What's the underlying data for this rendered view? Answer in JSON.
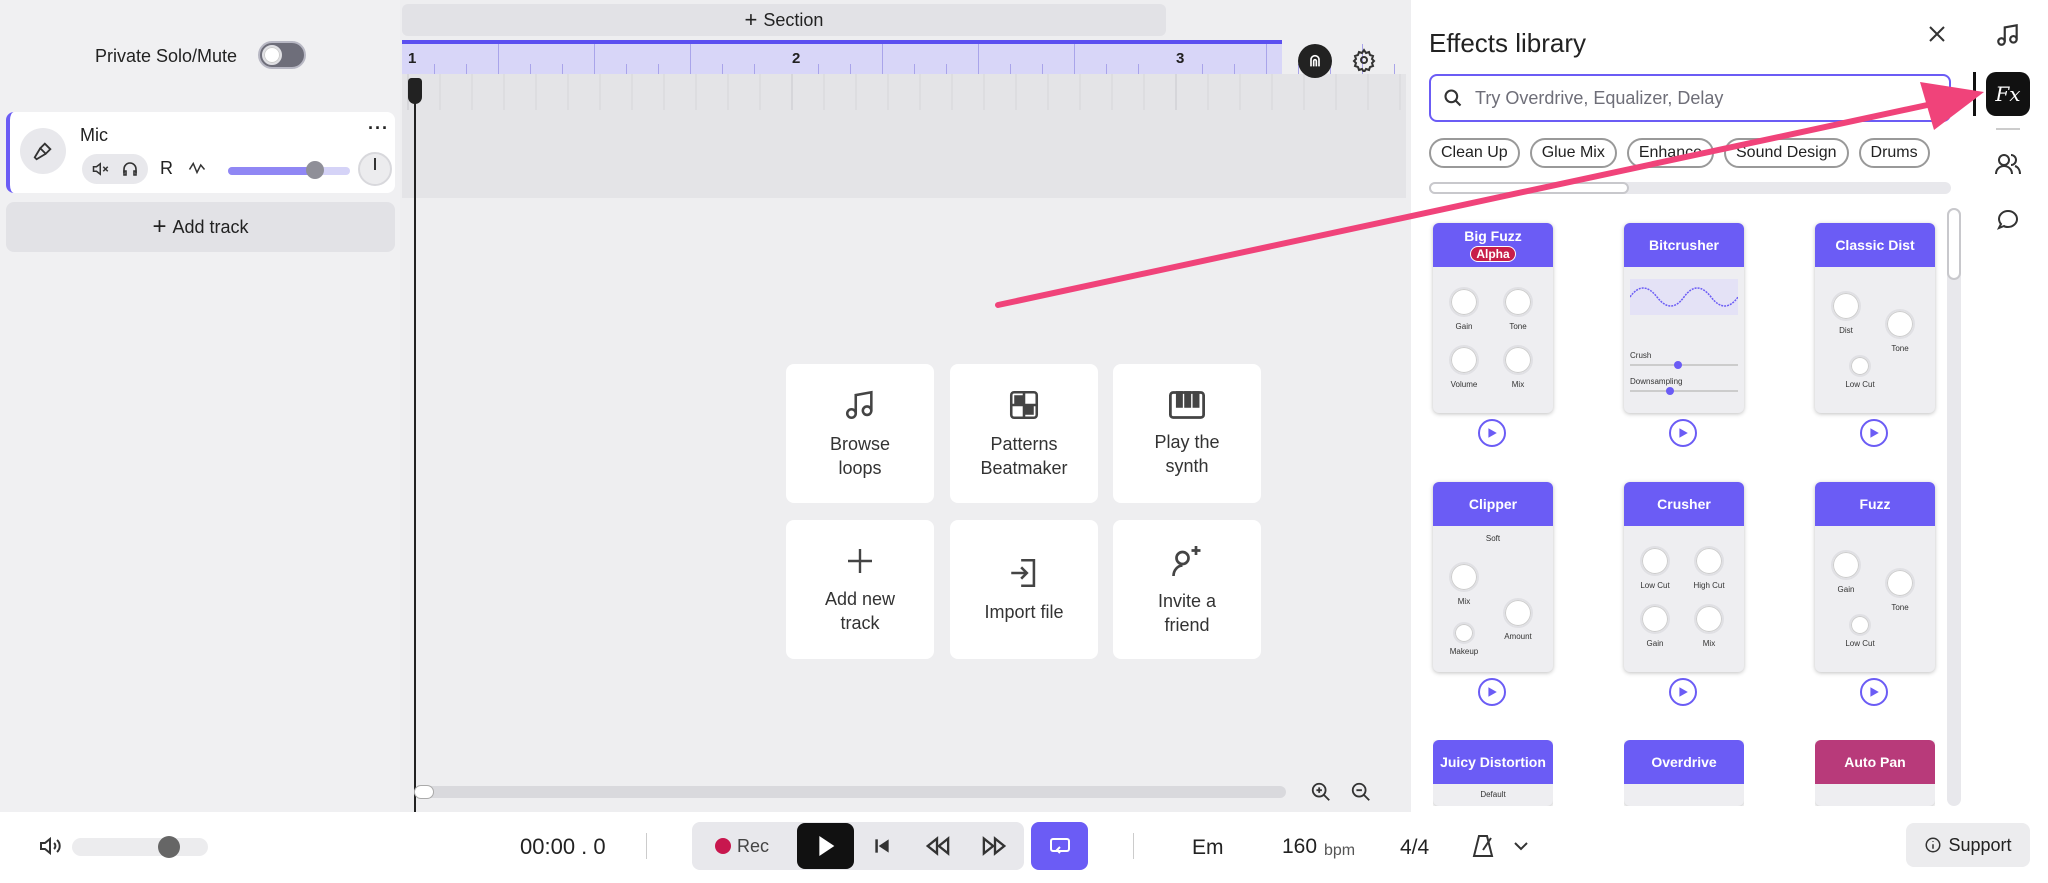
{
  "left": {
    "solo_label": "Private Solo/Mute",
    "track_name": "Mic",
    "more_label": "···",
    "record_label": "R",
    "add_track_label": "Add track"
  },
  "timeline": {
    "section_label": "Section",
    "bars": [
      "1",
      "2",
      "3"
    ]
  },
  "quick_actions": [
    {
      "line1": "Browse",
      "line2": "loops",
      "icon": "music-note-icon"
    },
    {
      "line1": "Patterns",
      "line2": "Beatmaker",
      "icon": "grid-pattern-icon"
    },
    {
      "line1": "Play the",
      "line2": "synth",
      "icon": "piano-icon"
    },
    {
      "line1": "Add new",
      "line2": "track",
      "icon": "plus-icon"
    },
    {
      "line1": "Import file",
      "line2": "",
      "icon": "import-icon"
    },
    {
      "line1": "Invite a",
      "line2": "friend",
      "icon": "invite-user-icon"
    }
  ],
  "effects": {
    "title": "Effects library",
    "search_placeholder": "Try Overdrive, Equalizer, Delay",
    "chips": [
      "Clean Up",
      "Glue Mix",
      "Enhance",
      "Sound Design",
      "Drums"
    ],
    "cards": [
      {
        "name": "Big Fuzz",
        "badge": "Alpha",
        "knobs": [
          "Gain",
          "Tone",
          "Volume",
          "Mix"
        ]
      },
      {
        "name": "Bitcrusher",
        "sliders": [
          "Crush",
          "Downsampling"
        ]
      },
      {
        "name": "Classic Dist",
        "knobs": [
          "Dist",
          "Tone",
          "Low Cut"
        ]
      },
      {
        "name": "Clipper",
        "dropdown": "Soft",
        "knobs": [
          "Mix",
          "Amount",
          "Makeup"
        ]
      },
      {
        "name": "Crusher",
        "knobs": [
          "Low Cut",
          "High Cut",
          "Gain",
          "Mix"
        ]
      },
      {
        "name": "Fuzz",
        "knobs": [
          "Gain",
          "Tone",
          "Low Cut"
        ]
      },
      {
        "name": "Juicy Distortion",
        "dropdown": "Default"
      },
      {
        "name": "Overdrive"
      },
      {
        "name": "Auto Pan"
      }
    ],
    "accent": "#6b5cf5",
    "pink": "#b83a7a"
  },
  "transport": {
    "time": "00:00 . 0",
    "rec_label": "Rec",
    "key": "Em",
    "tempo": "160",
    "tempo_unit": "bpm",
    "signature": "4/4",
    "support_label": "Support"
  },
  "annotation_arrow_color": "#f0437a"
}
